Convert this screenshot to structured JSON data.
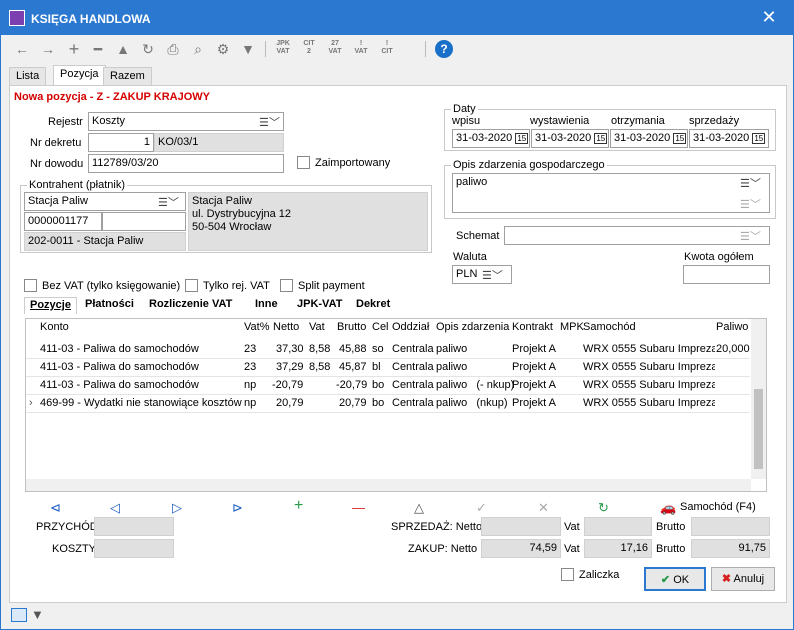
{
  "window": {
    "title": "KSIĘGA HANDLOWA",
    "close": "✕"
  },
  "toolbar": {
    "back": "←",
    "forward": "→",
    "add": "+",
    "remove": "━",
    "warn": "▲",
    "refresh": "↻",
    "print": "⎙",
    "preview": "⌕",
    "tools": "⚙",
    "filter": "▼",
    "jpk1": "JPK\nVAT",
    "cit2": "CIT\n2",
    "vat27": "27\nVAT",
    "vat": "!\nVAT",
    "cit": "!\nCIT",
    "help": "?"
  },
  "tabs": [
    "Lista",
    "Pozycja",
    "Razem"
  ],
  "header": {
    "title": "Nowa pozycja - Z - ZAKUP KRAJOWY"
  },
  "form": {
    "rejestr_label": "Rejestr",
    "rejestr": "Koszty",
    "nr_dekretu_label": "Nr dekretu",
    "nr_dekretu_num": "1",
    "nr_dekretu_code": "KO/03/1",
    "nr_dowodu_label": "Nr dowodu",
    "nr_dowodu": "112789/03/20",
    "zaimportowany": "Zaimportowany",
    "kontrahent_group": "Kontrahent (płatnik)",
    "kontrahent_name": "Stacja Paliw",
    "kontrahent_nip": "0000001177",
    "kontrahent_konto": "202-0011 - Stacja Paliw",
    "address_1": "Stacja Paliw",
    "address_2": "ul. Dystrybucyjna 12",
    "address_3": "50-504 Wrocław",
    "daty_group": "Daty",
    "wpisu_label": "wpisu",
    "wystawienia_label": "wystawienia",
    "otrzymania_label": "otrzymania",
    "sprzedazy_label": "sprzedaży",
    "wpisu": "31-03-2020",
    "wystawienia": "31-03-2020",
    "otrzymania": "31-03-2020",
    "sprzedazy": "31-03-2020",
    "cal": "15",
    "opis_group": "Opis zdarzenia gospodarczego",
    "opis": "paliwo",
    "schemat_label": "Schemat",
    "waluta_label": "Waluta",
    "waluta": "PLN",
    "kwota_label": "Kwota ogółem",
    "bez_vat": "Bez VAT (tylko księgowanie)",
    "tylko_rej": "Tylko rej. VAT",
    "split": "Split payment"
  },
  "bottom_tabs": [
    "Pozycje",
    "Płatności",
    "Rozliczenie VAT",
    "Inne",
    "JPK-VAT",
    "Dekret"
  ],
  "grid": {
    "headers": [
      "Konto",
      "Vat%",
      "Netto",
      "Vat",
      "Brutto",
      "Cel",
      "Oddział",
      "Opis zdarzenia",
      "Kontrakt",
      "MPK",
      "Samochód",
      "Paliwo"
    ],
    "rows": [
      [
        "411-03 - Paliwa do samochodów",
        "23",
        "37,30",
        "8,58",
        "45,88",
        "so",
        "Centrala",
        "paliwo",
        "Projekt A",
        "",
        "WRX 0555 Subaru Impreza",
        "20,000"
      ],
      [
        "411-03 - Paliwa do samochodów",
        "23",
        "37,29",
        "8,58",
        "45,87",
        "bl",
        "Centrala",
        "paliwo",
        "Projekt A",
        "",
        "WRX 0555 Subaru Impreza",
        ""
      ],
      [
        "411-03 - Paliwa do samochodów",
        "np",
        "-20,79",
        "",
        "-20,79",
        "bo",
        "Centrala",
        "paliwo   (- nkup)",
        "Projekt A",
        "",
        "WRX 0555 Subaru Impreza",
        ""
      ],
      [
        "469-99 - Wydatki nie stanowiące kosztów",
        "np",
        "20,79",
        "",
        "20,79",
        "bo",
        "Centrala",
        "paliwo   (nkup)",
        "Projekt A",
        "",
        "WRX 0555 Subaru Impreza",
        ""
      ]
    ]
  },
  "nav": {
    "first": "⊲",
    "prev": "◁",
    "next": "▷",
    "last": "⊳",
    "add": "+",
    "del": "—",
    "warn": "△",
    "ok": "✓",
    "cancel": "✕",
    "refresh": "↻",
    "samochod": "Samochód (F4)"
  },
  "totals": {
    "przychod": "PRZYCHÓD",
    "koszty": "KOSZTY",
    "sprzedaz": "SPRZEDAŻ: Netto",
    "zakup": "ZAKUP: Netto",
    "vat": "Vat",
    "brutto": "Brutto",
    "zakup_netto": "74,59",
    "zakup_vat": "17,16",
    "zakup_brutto": "91,75"
  },
  "footer": {
    "zaliczka": "Zaliczka",
    "ok": "OK",
    "anuluj": "Anuluj"
  }
}
